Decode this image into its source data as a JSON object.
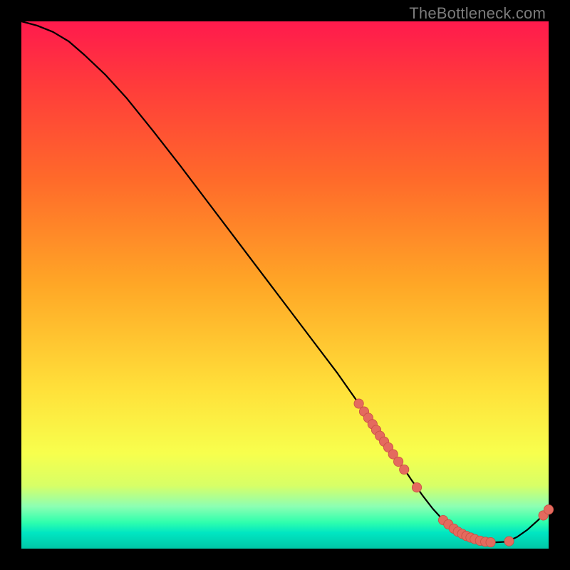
{
  "watermark": "TheBottleneck.com",
  "colors": {
    "line": "#000000",
    "marker_fill": "#e46a5e",
    "marker_stroke": "#c94f43"
  },
  "chart_data": {
    "type": "line",
    "title": "",
    "xlabel": "",
    "ylabel": "",
    "xlim": [
      0,
      100
    ],
    "ylim": [
      0,
      100
    ],
    "grid": false,
    "legend": false,
    "series": [
      {
        "name": "bottleneck-curve",
        "x": [
          0,
          3,
          6,
          9,
          12,
          16,
          20,
          25,
          30,
          35,
          40,
          45,
          50,
          55,
          60,
          64,
          66,
          67,
          68,
          70,
          72,
          74,
          76,
          78,
          80,
          82,
          84,
          86,
          88,
          90,
          92,
          94,
          96,
          98,
          100
        ],
        "y": [
          100,
          99.2,
          98.0,
          96.2,
          93.6,
          89.8,
          85.4,
          79.2,
          72.8,
          66.2,
          59.6,
          53.0,
          46.4,
          39.8,
          33.2,
          27.5,
          24.6,
          23.1,
          21.6,
          18.8,
          16.0,
          13.0,
          10.2,
          7.6,
          5.4,
          3.8,
          2.6,
          1.8,
          1.3,
          1.2,
          1.3,
          2.2,
          3.6,
          5.4,
          7.4
        ]
      }
    ],
    "markers": [
      {
        "x": 64.0,
        "y": 27.5
      },
      {
        "x": 65.0,
        "y": 26.0
      },
      {
        "x": 65.8,
        "y": 24.8
      },
      {
        "x": 66.6,
        "y": 23.6
      },
      {
        "x": 67.3,
        "y": 22.5
      },
      {
        "x": 68.0,
        "y": 21.4
      },
      {
        "x": 68.8,
        "y": 20.3
      },
      {
        "x": 69.6,
        "y": 19.2
      },
      {
        "x": 70.5,
        "y": 17.9
      },
      {
        "x": 71.5,
        "y": 16.5
      },
      {
        "x": 72.6,
        "y": 15.0
      },
      {
        "x": 75.0,
        "y": 11.6
      },
      {
        "x": 80.0,
        "y": 5.4
      },
      {
        "x": 81.0,
        "y": 4.6
      },
      {
        "x": 82.0,
        "y": 3.8
      },
      {
        "x": 82.8,
        "y": 3.2
      },
      {
        "x": 83.6,
        "y": 2.8
      },
      {
        "x": 84.4,
        "y": 2.4
      },
      {
        "x": 85.2,
        "y": 2.1
      },
      {
        "x": 86.0,
        "y": 1.8
      },
      {
        "x": 87.0,
        "y": 1.5
      },
      {
        "x": 88.0,
        "y": 1.3
      },
      {
        "x": 89.0,
        "y": 1.2
      },
      {
        "x": 92.5,
        "y": 1.4
      },
      {
        "x": 99.0,
        "y": 6.3
      },
      {
        "x": 100.0,
        "y": 7.4
      }
    ],
    "marker_radius_data_units": 0.9
  }
}
